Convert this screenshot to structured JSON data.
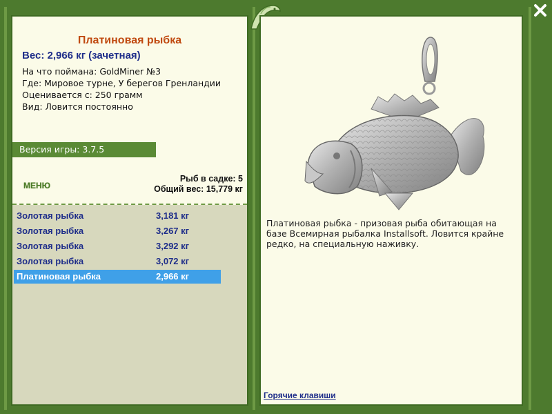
{
  "window": {
    "close_label": "X"
  },
  "fish": {
    "title": "Платиновая рыбка",
    "weight_line": "Вес: 2,966 кг (зачетная)",
    "caught_with": "На что поймана: GoldMiner №3",
    "where": "Где: Мировое турне, У берегов Гренландии",
    "valued_from": "Оценивается с: 250 грамм",
    "kind": "Вид: Ловится постоянно"
  },
  "version": {
    "label": "Версия игры: 3.7.5"
  },
  "menu": {
    "label": "МЕНЮ"
  },
  "cage": {
    "fish_count": "Рыб в садке: 5",
    "total_weight": "Общий вес: 15,779 кг"
  },
  "catch_list": [
    {
      "name": "Золотая рыбка",
      "weight": "3,181 кг",
      "selected": false
    },
    {
      "name": "Золотая рыбка",
      "weight": "3,267 кг",
      "selected": false
    },
    {
      "name": "Золотая рыбка",
      "weight": "3,292 кг",
      "selected": false
    },
    {
      "name": "Золотая рыбка",
      "weight": "3,072 кг",
      "selected": false
    },
    {
      "name": "Платиновая рыбка",
      "weight": "2,966 кг",
      "selected": true
    }
  ],
  "description": "Платиновая рыбка - призовая рыба обитающая на базе Всемирная рыбалка Installsoft. Ловится крайне редко, на специальную наживку.",
  "hotkeys_link": "Горячие клавиши",
  "colors": {
    "frame": "#4d7a2e",
    "panel": "#fbfbe8",
    "title": "#c04a10",
    "weight": "#1f2e8a",
    "selection": "#3fa0e8",
    "version_bar": "#5a8a35"
  }
}
